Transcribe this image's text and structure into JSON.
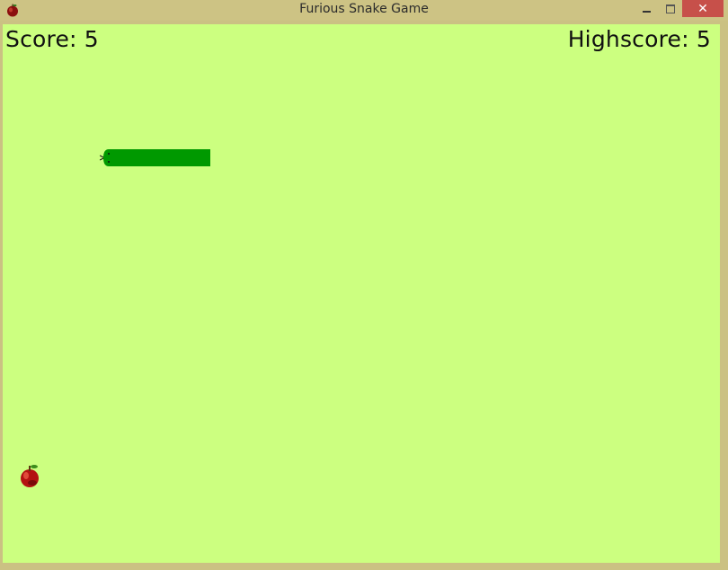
{
  "window": {
    "title": "Furious Snake Game",
    "icon": "apple-icon",
    "controls": {
      "minimize_icon": "minimize-icon",
      "maximize_icon": "maximize-icon",
      "close_label": "✕"
    }
  },
  "game": {
    "score_text": "Score: 5",
    "highscore_text": "Highscore: 5",
    "score": 5,
    "highscore": 5,
    "background_color": "#ccff80",
    "snake_color": "#009900",
    "apple_icon": "apple-icon",
    "snake_head_icon": "snake-head-icon"
  }
}
